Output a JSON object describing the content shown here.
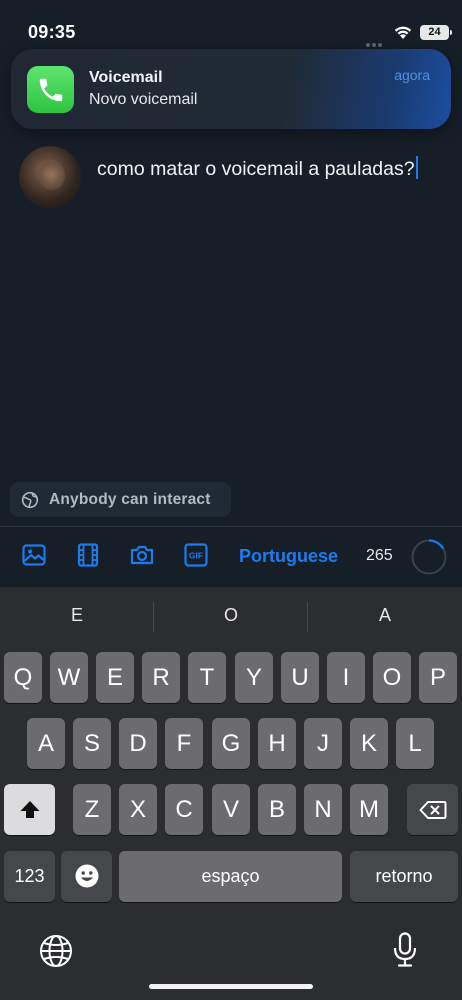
{
  "status_bar": {
    "time": "09:35",
    "battery": "24"
  },
  "notification": {
    "app": "Voicemail",
    "message": "Novo voicemail",
    "time": "agora",
    "icon": "phone-icon",
    "icon_color": "#34c759"
  },
  "compose": {
    "text": "como matar o voicemail a pauladas?",
    "audience": "Anybody can interact"
  },
  "toolbar": {
    "icons": [
      "image-icon",
      "video-icon",
      "camera-icon",
      "gif-icon"
    ],
    "gif_label": "GIF",
    "language": "Portuguese",
    "char_count": "265",
    "accent": "#1d7bf0"
  },
  "keyboard": {
    "suggestions": [
      "E",
      "O",
      "A"
    ],
    "row1": [
      "Q",
      "W",
      "E",
      "R",
      "T",
      "Y",
      "U",
      "I",
      "O",
      "P"
    ],
    "row2": [
      "A",
      "S",
      "D",
      "F",
      "G",
      "H",
      "J",
      "K",
      "L"
    ],
    "row3": [
      "Z",
      "X",
      "C",
      "V",
      "B",
      "N",
      "M"
    ],
    "numbers_label": "123",
    "space_label": "espaço",
    "return_label": "retorno"
  }
}
